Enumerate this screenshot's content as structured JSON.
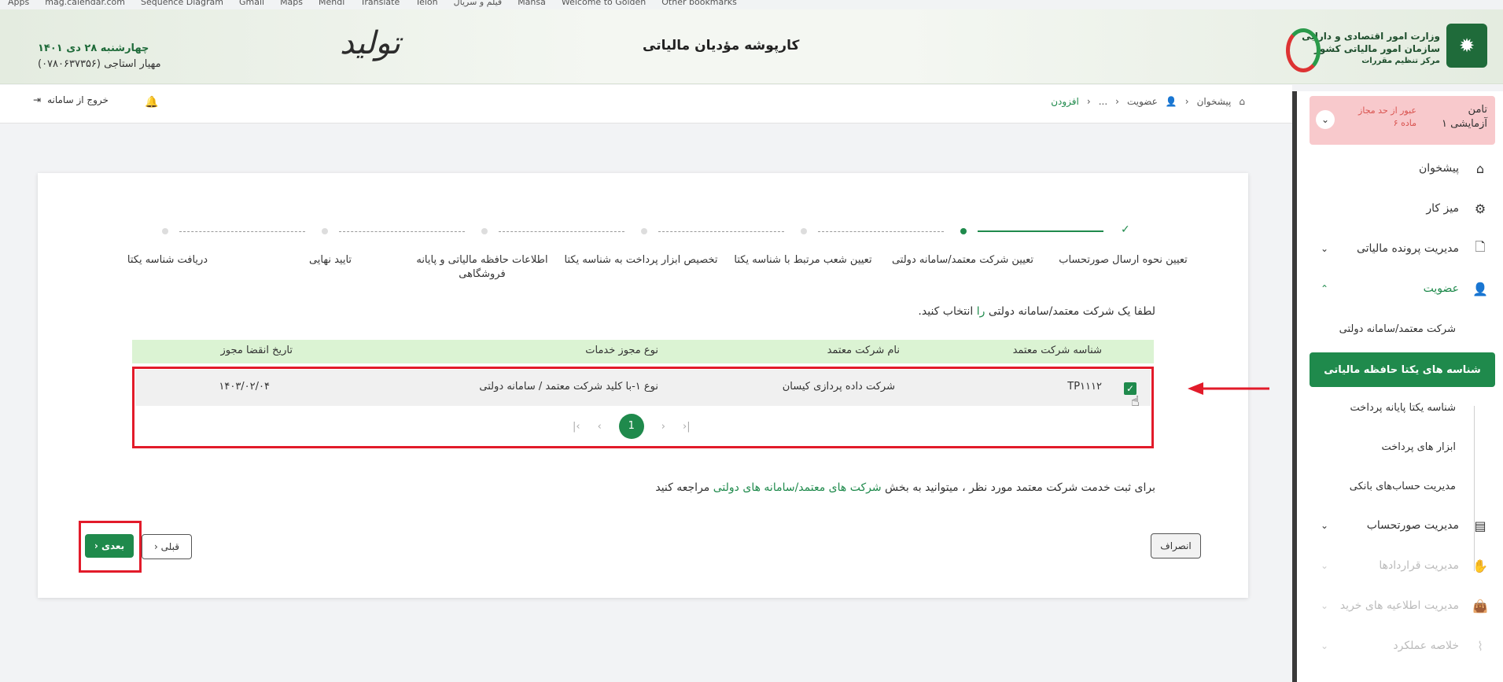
{
  "bookmarks": [
    "Apps",
    "mag.calendar.com",
    "Sequence Diagram",
    "Gmail",
    "Maps",
    "Mehdi",
    "Translate",
    "Telon",
    "فیلم و سریال",
    "Mahsa",
    "Welcome to Golden",
    "Other bookmarks"
  ],
  "header": {
    "org_line1": "وزارت امور اقتصادی و دارایی",
    "org_line2": "سازمان امور مالیاتی کشور",
    "org_line3": "مرکز تنظیم مقررات",
    "app_title": "کارپوشه مؤدیان مالیاتی",
    "tolid_text": "تولید",
    "date": "چهارشنبه ۲۸ دی ۱۴۰۱",
    "user": "مهیار استاجی (۰۷۸۰۶۳۷۳۵۶)"
  },
  "topbar": {
    "breadcrumb": [
      "پیشخوان",
      "عضویت",
      "...",
      "افزودن"
    ],
    "logout_label": "خروج از سامانه"
  },
  "sidebar": {
    "user_name1": "تامن",
    "user_name2": "آزمایشی ۱",
    "warning1": "عبور از حد مجاز",
    "warning2": "ماده ۶",
    "items": [
      {
        "label": "پیشخوان",
        "icon": "home-icon"
      },
      {
        "label": "میز کار",
        "icon": "workflow-icon"
      },
      {
        "label": "مدیریت پرونده مالیاتی",
        "icon": "file-icon"
      },
      {
        "label": "عضویت",
        "icon": "user-icon"
      },
      {
        "label": "مدیریت صورتحساب",
        "icon": "invoice-icon"
      },
      {
        "label": "مدیریت قراردادها",
        "icon": "handshake-icon"
      },
      {
        "label": "مدیریت اطلاعیه های خرید",
        "icon": "shopping-bag-icon"
      },
      {
        "label": "خلاصه عملکرد",
        "icon": "chart-icon"
      }
    ],
    "sub_items": [
      "شرکت معتمد/سامانه دولتی",
      "شناسه های یکتا حافظه مالیاتی",
      "شناسه یکتا پایانه پرداخت",
      "ابزار های پرداخت",
      "مدیریت حساب‌های بانکی"
    ]
  },
  "wizard": {
    "steps": [
      "تعیین نحوه ارسال صورتحساب",
      "تعیین شرکت معتمد/سامانه دولتی",
      "تعیین شعب مرتبط با شناسه یکتا",
      "تخصیص ابزار پرداخت به شناسه یکتا",
      "اطلاعات حافظه مالیاتی و پایانه فروشگاهی",
      "تایید نهایی",
      "دریافت شناسه یکتا"
    ],
    "current_step": 2
  },
  "instruction": {
    "before": "لطفا یک شرکت معتمد/سامانه دولتی ",
    "highlight": "را",
    "after": " انتخاب کنید."
  },
  "table": {
    "headers": [
      "شناسه شرکت معتمد",
      "نام شرکت معتمد",
      "نوع مجوز خدمات",
      "تاریخ انقضا مجوز"
    ],
    "rows": [
      {
        "id": "TP۱۱۱۲",
        "name": "شرکت داده پردازی کیسان",
        "license": "نوع ۱-با کلید شرکت معتمد / سامانه دولتی",
        "expiry": "۱۴۰۳/۰۲/۰۴",
        "selected": true
      }
    ],
    "page": "1"
  },
  "note": {
    "before": "برای ثبت خدمت شرکت معتمد مورد نظر ، میتوانید به بخش ",
    "link": "شرکت های معتمد/سامانه های دولتی",
    "after": " مراجعه کنید"
  },
  "buttons": {
    "cancel": "انصراف",
    "prev": "قبلی",
    "next": "بعدی"
  },
  "colors": {
    "accent": "#1f8a4c",
    "annotation": "#e21b2a",
    "table_header": "#dbf3d3"
  }
}
